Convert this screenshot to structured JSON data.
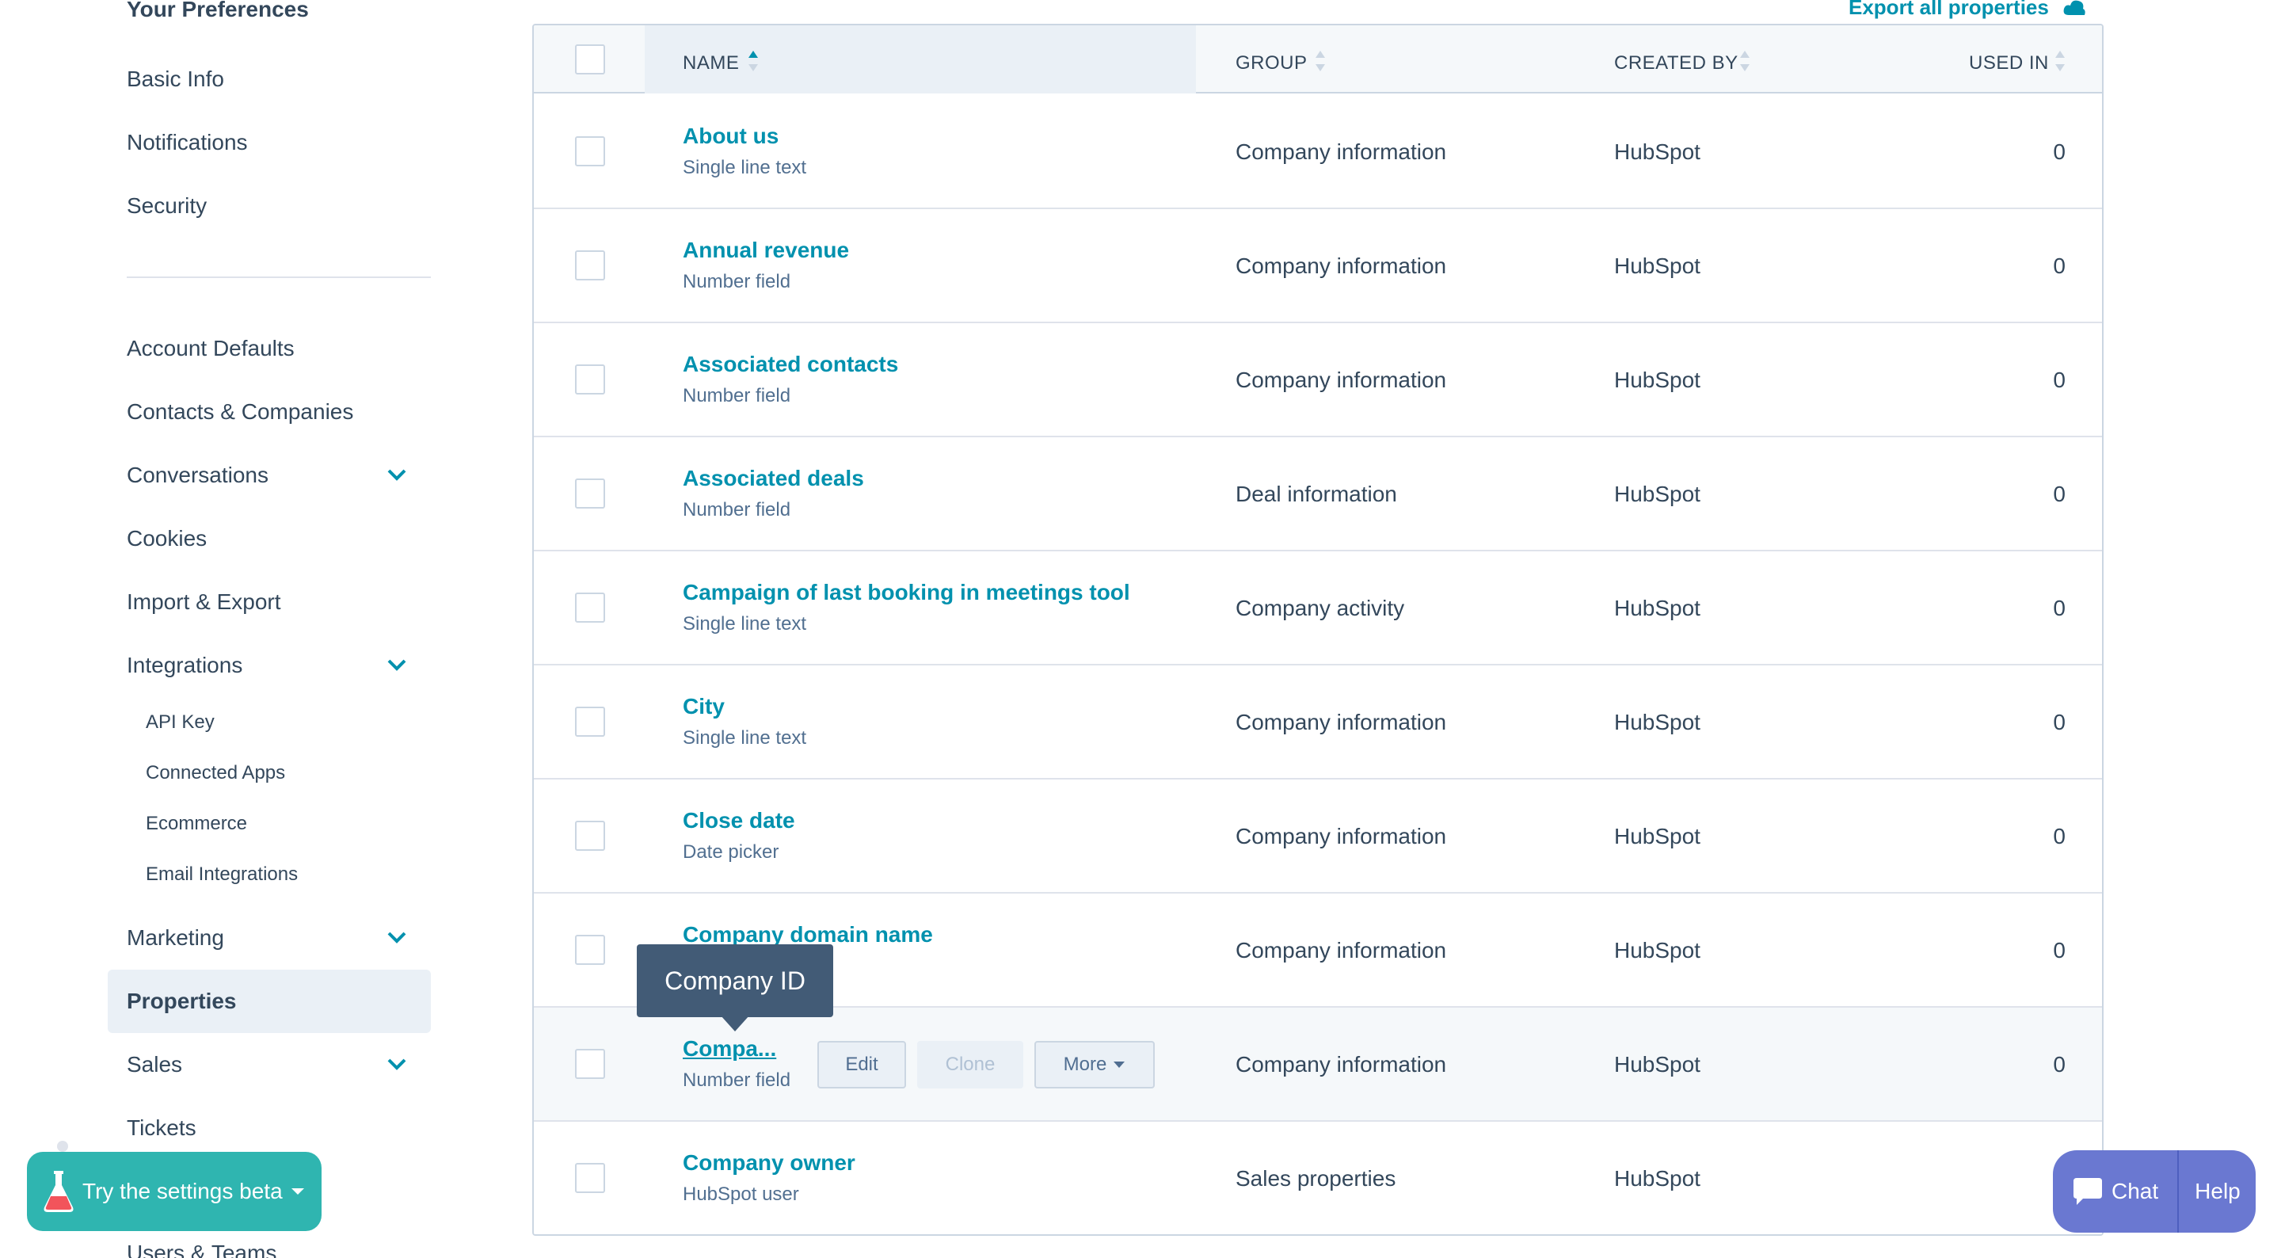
{
  "sidebar": {
    "section_title": "Your Preferences",
    "prefs": [
      "Basic Info",
      "Notifications",
      "Security"
    ],
    "items": [
      {
        "label": "Account Defaults",
        "expandable": false
      },
      {
        "label": "Contacts & Companies",
        "expandable": false
      },
      {
        "label": "Conversations",
        "expandable": true
      },
      {
        "label": "Cookies",
        "expandable": false
      },
      {
        "label": "Import & Export",
        "expandable": false
      },
      {
        "label": "Integrations",
        "expandable": true
      },
      {
        "label": "Marketing",
        "expandable": true
      },
      {
        "label": "Properties",
        "expandable": false,
        "active": true
      },
      {
        "label": "Sales",
        "expandable": true
      },
      {
        "label": "Tickets",
        "expandable": false
      },
      {
        "label": "Users & Teams",
        "expandable": false
      }
    ],
    "integrations_sub": [
      "API Key",
      "Connected Apps",
      "Ecommerce",
      "Email Integrations"
    ]
  },
  "toolbar": {
    "export_label": "Export all properties"
  },
  "table": {
    "headers": {
      "name": "NAME",
      "group": "GROUP",
      "created_by": "CREATED BY",
      "used_in": "USED IN"
    },
    "rows": [
      {
        "name": "About us",
        "type": "Single line text",
        "group": "Company information",
        "created_by": "HubSpot",
        "used_in": "0"
      },
      {
        "name": "Annual revenue",
        "type": "Number field",
        "group": "Company information",
        "created_by": "HubSpot",
        "used_in": "0"
      },
      {
        "name": "Associated contacts",
        "type": "Number field",
        "group": "Company information",
        "created_by": "HubSpot",
        "used_in": "0"
      },
      {
        "name": "Associated deals",
        "type": "Number field",
        "group": "Deal information",
        "created_by": "HubSpot",
        "used_in": "0"
      },
      {
        "name": "Campaign of last booking in meetings tool",
        "type": "Single line text",
        "group": "Company activity",
        "created_by": "HubSpot",
        "used_in": "0"
      },
      {
        "name": "City",
        "type": "Single line text",
        "group": "Company information",
        "created_by": "HubSpot",
        "used_in": "0"
      },
      {
        "name": "Close date",
        "type": "Date picker",
        "group": "Company information",
        "created_by": "HubSpot",
        "used_in": "0"
      },
      {
        "name": "Company domain name",
        "type": "",
        "group": "Company information",
        "created_by": "HubSpot",
        "used_in": "0"
      },
      {
        "name": "Compa...",
        "type": "Number field",
        "group": "Company information",
        "created_by": "HubSpot",
        "used_in": "0"
      },
      {
        "name": "Company owner",
        "type": "HubSpot user",
        "group": "Sales properties",
        "created_by": "HubSpot",
        "used_in": ""
      }
    ],
    "row_actions": {
      "edit": "Edit",
      "clone": "Clone",
      "more": "More"
    }
  },
  "tooltip": {
    "text": "Company ID"
  },
  "beta": {
    "label": "Try the settings beta"
  },
  "chat": {
    "chat_label": "Chat",
    "help_label": "Help"
  },
  "colors": {
    "link": "#0091ae",
    "text": "#33475b",
    "beta_bg": "#2fb5b0",
    "chat_bg": "#6a78d1",
    "tooltip_bg": "#425b76"
  }
}
